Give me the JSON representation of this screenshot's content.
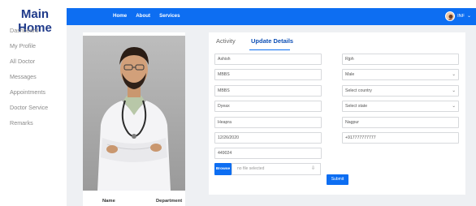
{
  "sidebar": {
    "brand": "Main Home",
    "items": [
      {
        "label": "Dashboard"
      },
      {
        "label": "My Profile"
      },
      {
        "label": "All Doctor"
      },
      {
        "label": "Messages"
      },
      {
        "label": "Appointments"
      },
      {
        "label": "Doctor Service"
      },
      {
        "label": "Remarks"
      }
    ]
  },
  "topbar": {
    "nav": [
      {
        "label": "Home"
      },
      {
        "label": "About"
      },
      {
        "label": "Services"
      }
    ],
    "user_label": "INF",
    "user_caret": "⌄"
  },
  "profile": {
    "name_label": "Name",
    "department_label": "Department"
  },
  "tabs": {
    "activity": "Activity",
    "update": "Update Details"
  },
  "form": {
    "first_name": "Ashish",
    "last_name": "Rjph",
    "field_3": "MBBS",
    "gender": "Male",
    "field_5": "MBBS",
    "country": "Select country",
    "field_7": "Dyeax",
    "state": "Select state",
    "field_9": "Heapra",
    "city": "Nagpur",
    "dob": "12/26/2020",
    "phone": "+917777777777",
    "pincode": "449024",
    "browse_label": "Browse",
    "file_status": "no file selected",
    "upload_icon": "⇩",
    "submit_label": "Submit"
  },
  "colors": {
    "accent": "#0d6ef2",
    "brand": "#1f3a8a",
    "content_bg": "#eef0f3"
  }
}
